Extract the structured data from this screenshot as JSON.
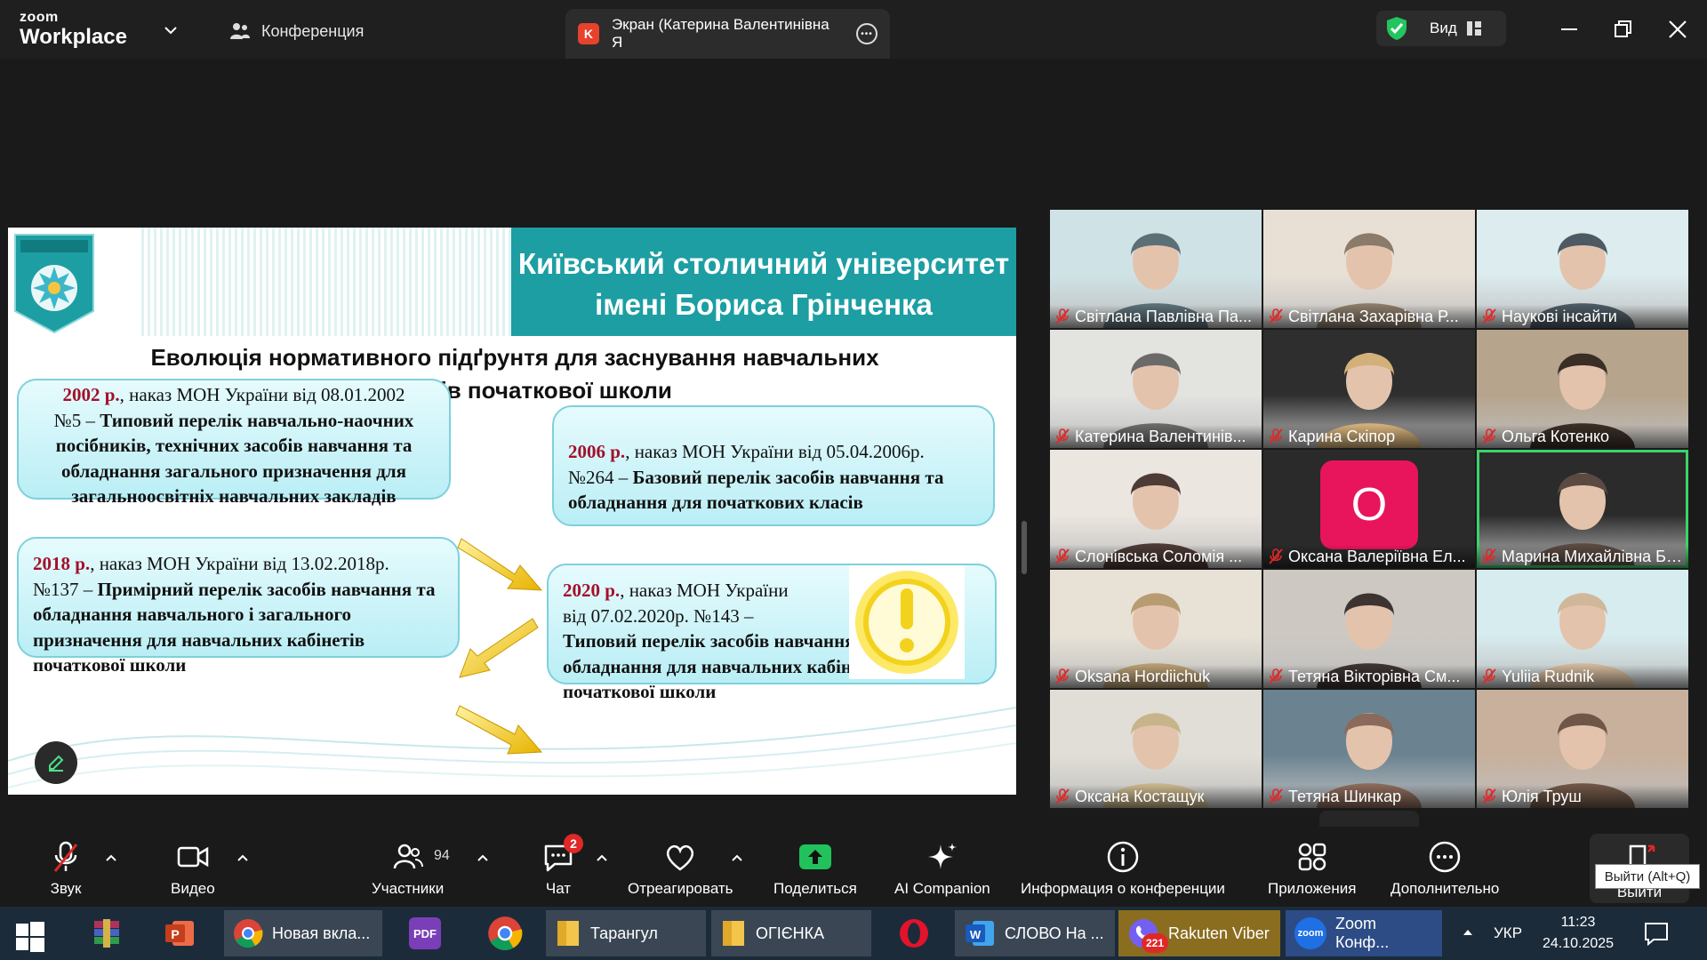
{
  "window": {
    "logo_top": "zoom",
    "logo_bottom": "Workplace",
    "conference_label": "Конференция",
    "screen_tab_badge": "K",
    "screen_tab_label": "Экран (Катерина Валентинівна Я",
    "view_label": "Вид"
  },
  "slide": {
    "university_title_line1": "Київський столичний університет",
    "university_title_line2": "імені Бориса Грінченка",
    "subtitle_line1": "Еволюція нормативного підґрунтя для заснування навчальних",
    "subtitle_line2": "кабінетів початкової школи",
    "box_2002": {
      "year": "2002 р.",
      "text1": ", наказ МОН України від 08.01.2002",
      "text2": "№5  – ",
      "bold": "Типовий перелік навчально-наочних посібників, технічних засобів навчання та обладнання загального призначення для загальноосвітніх навчальних закладів"
    },
    "box_2006": {
      "year": "2006 р.",
      "text1": ", наказ МОН України від 05.04.2006р.",
      "text2": "№264 – ",
      "bold": "Базовий перелік засобів навчання та обладнання для початкових класів"
    },
    "box_2018": {
      "year": "2018 р.",
      "text1": ", наказ МОН України від 13.02.2018р.",
      "text2": "№137 – ",
      "bold": "Примірний перелік засобів навчання та обладнання навчального і загального призначення для навчальних кабінетів початкової школи"
    },
    "box_2020": {
      "year": "2020 р.",
      "text1": ", наказ МОН України",
      "text2": "від 07.02.2020р. №143 –",
      "bold": "Типовий перелік засобів навчання та обладнання для навчальних кабінетів початкової школи"
    }
  },
  "participants": [
    "Світлана Павлівна Па...",
    "Світлана Захарівна Р...",
    "Наукові інсайти",
    "Катерина Валентинів...",
    "Карина Скіпор",
    "Ольга Котенко",
    "Слонівська Соломія ...",
    "Оксана Валеріївна Ел...",
    "Марина Михайлівна Бог...",
    "Oksana Hordiichuk",
    "Тетяна Вікторівна См...",
    "Yuliia Rudnik",
    "Оксана Костащук",
    "Тетяна Шинкар",
    "Юлія Труш"
  ],
  "avatar_letter": "O",
  "toolbar": {
    "audio": "Звук",
    "video": "Видео",
    "participants": "Участники",
    "participants_count": "94",
    "chat": "Чат",
    "chat_badge": "2",
    "react": "Отреагировать",
    "share": "Поделиться",
    "ai": "AI Companion",
    "info": "Информация о конференции",
    "apps": "Приложения",
    "more": "Дополнительно",
    "leave": "Выйти",
    "leave_tooltip": "Выйти (Alt+Q)"
  },
  "taskbar": {
    "chrome1": "Новая вкла...",
    "folder1": "Тарангул",
    "folder2": "ОГІЄНКА",
    "word": "СЛОВО На ...",
    "viber": "Rakuten Viber",
    "viber_badge": "221",
    "zoom": "Zoom Конф...",
    "zoom_icon": "zoom",
    "pdf_label": "PDF",
    "lang": "УКР",
    "time": "11:23",
    "date": "24.10.2025"
  },
  "colors": {
    "accent_green": "#3bd36a",
    "teal": "#1d9ea3",
    "year_red": "#a3102a",
    "muted_red": "#e02828"
  }
}
